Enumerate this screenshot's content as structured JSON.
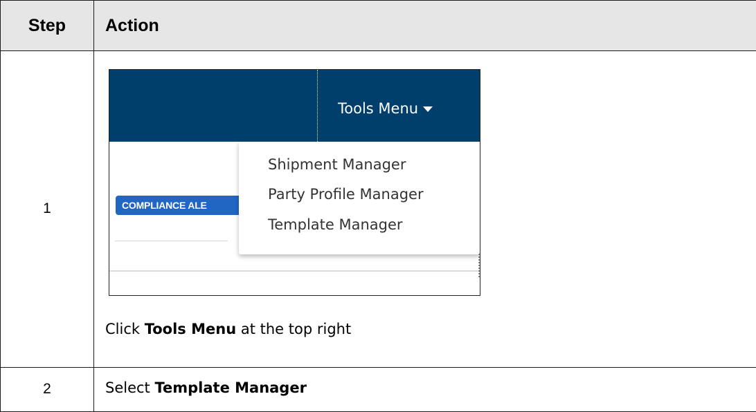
{
  "table": {
    "header_step": "Step",
    "header_action": "Action"
  },
  "rows": [
    {
      "step": "1",
      "instruction_prefix": "Click ",
      "instruction_bold": "Tools Menu",
      "instruction_suffix": " at the top right"
    },
    {
      "step": "2",
      "instruction_prefix": "Select ",
      "instruction_bold": "Template Manager",
      "instruction_suffix": ""
    }
  ],
  "screenshot": {
    "tools_menu_label": "Tools Menu",
    "badge_label": "COMPLIANCE ALE",
    "menu_items": [
      "Shipment Manager",
      "Party Profile Manager",
      "Template Manager"
    ],
    "colors": {
      "nav_bar": "#003f6b",
      "badge": "#2167c2",
      "menu_text": "#333333"
    }
  }
}
